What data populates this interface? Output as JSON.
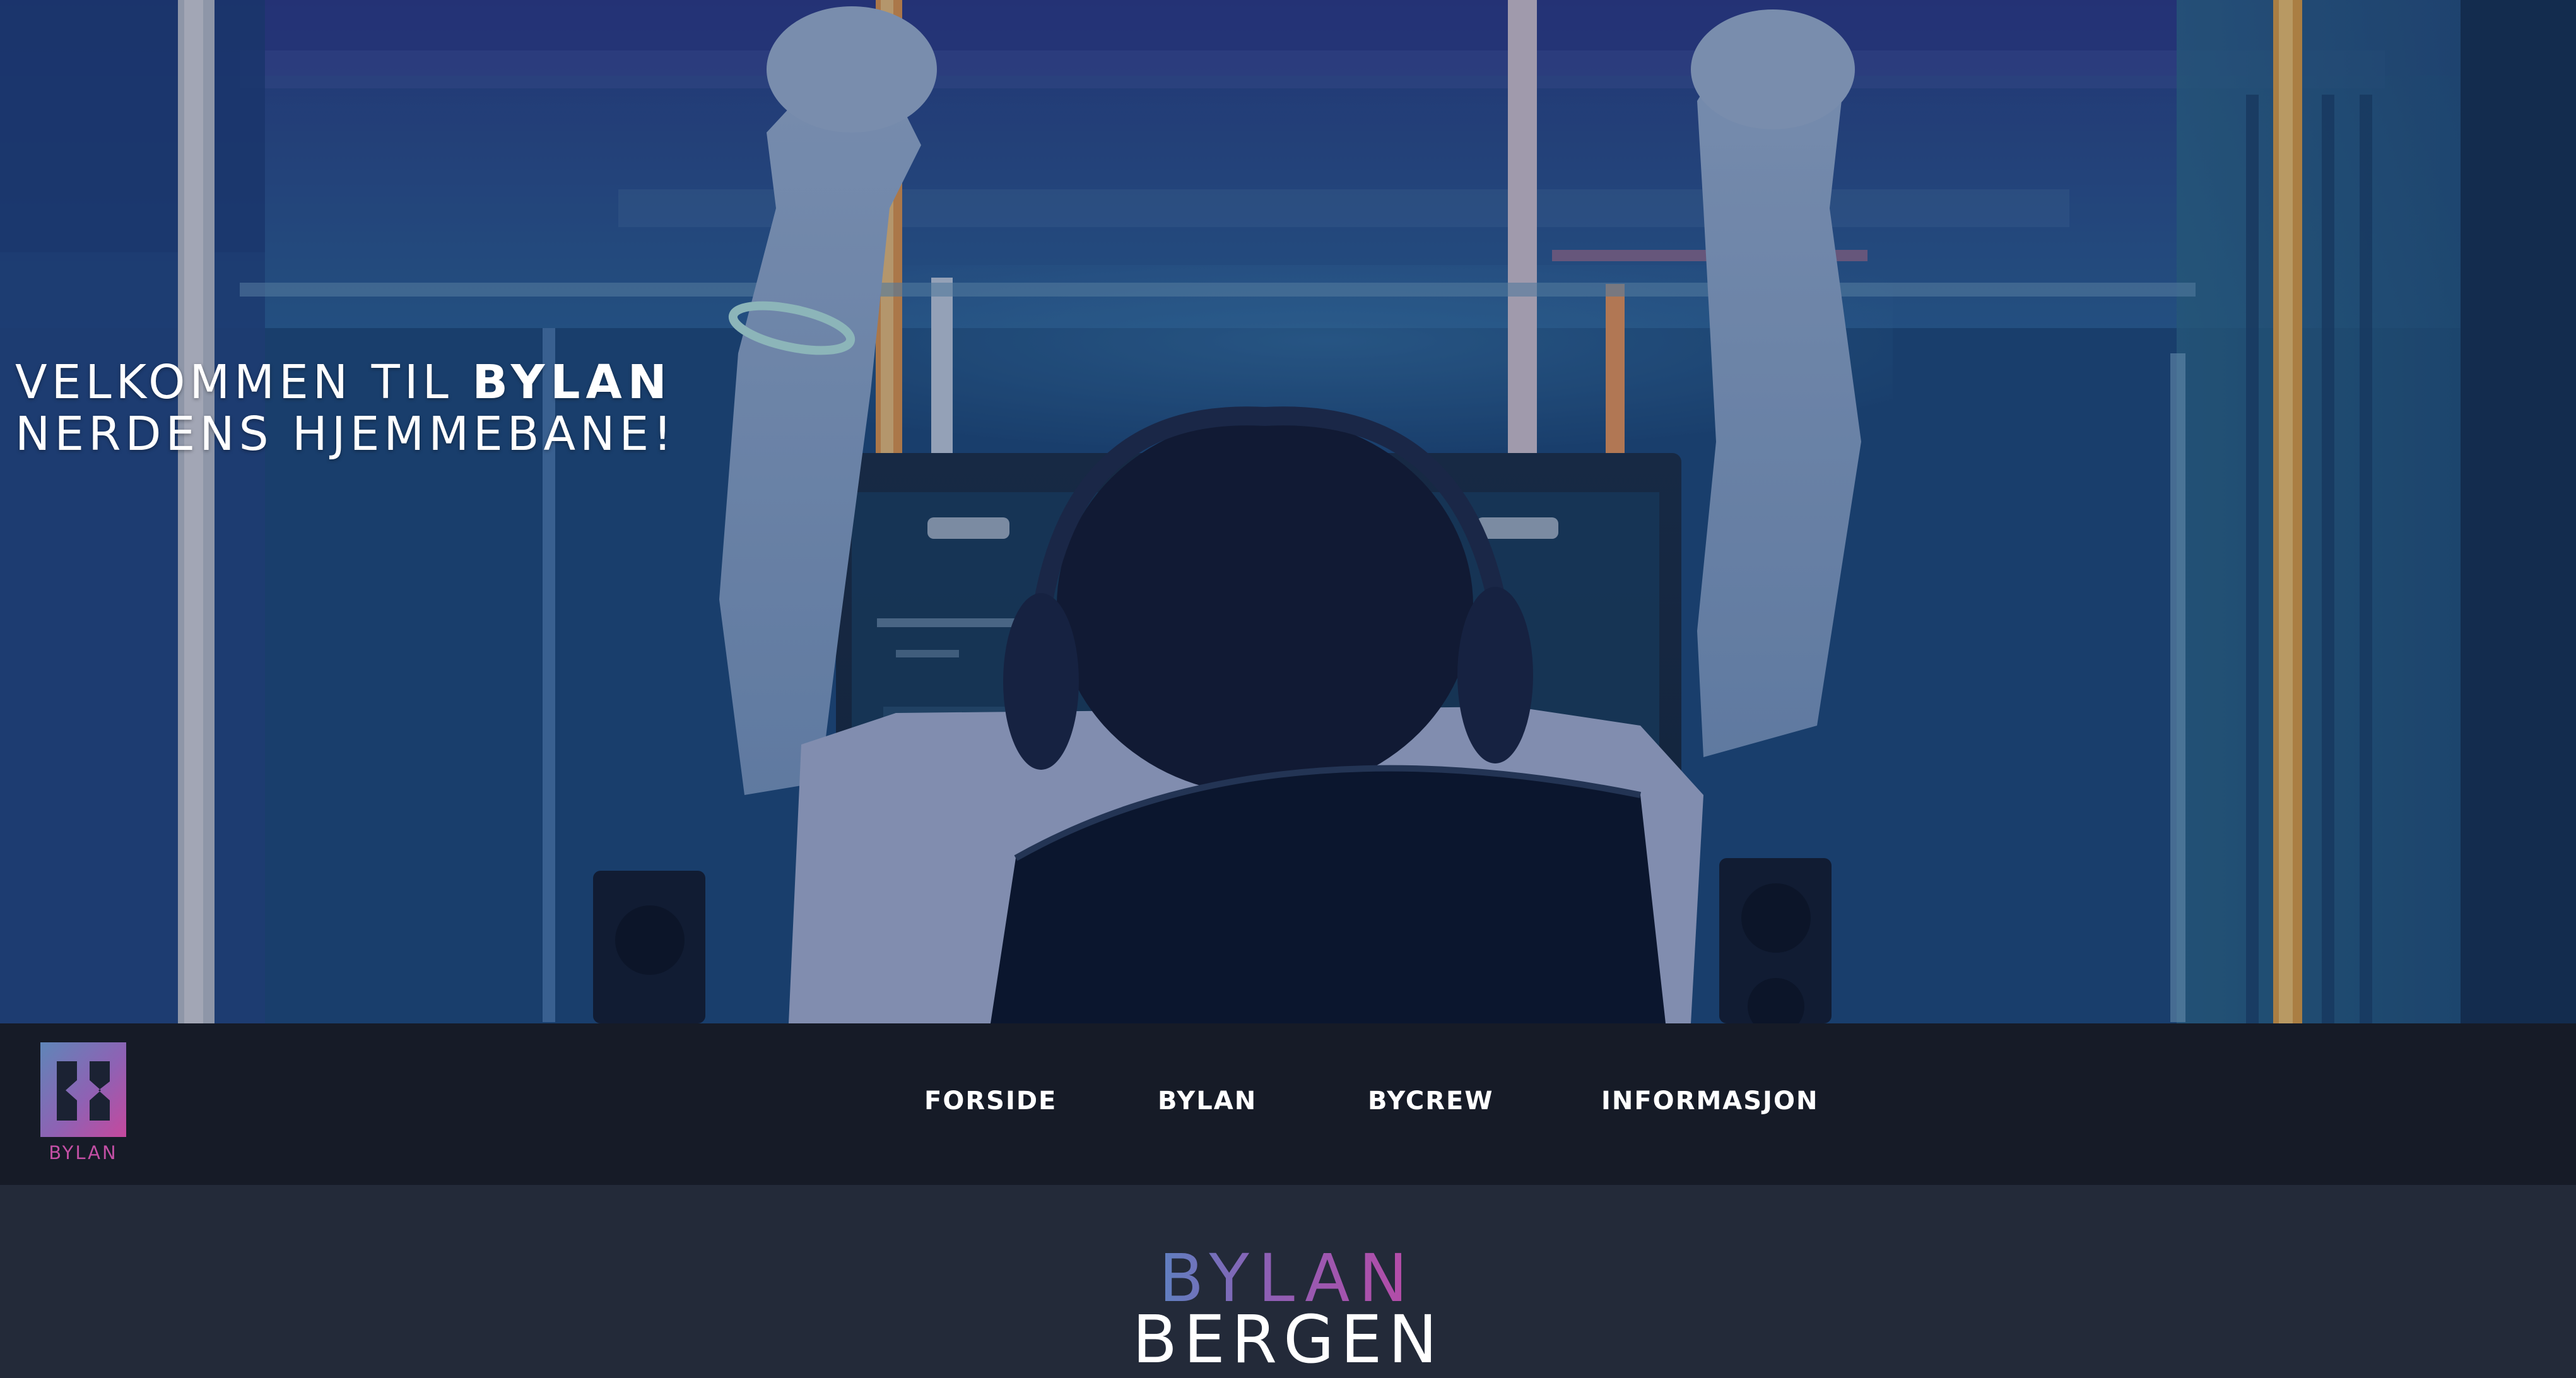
{
  "hero": {
    "line1_prefix": "VELKOMMEN TIL ",
    "line1_brand": "BYLAN",
    "line2": "NERDENS HJEMMEBANE!"
  },
  "navbar": {
    "logo_text": "BYLAN",
    "links": [
      {
        "label": "FORSIDE"
      },
      {
        "label": "BYLAN"
      },
      {
        "label": "BYCREW"
      },
      {
        "label": "INFORMASJON"
      }
    ]
  },
  "content": {
    "title": "BYLAN",
    "subtitle": "BERGEN"
  },
  "colors": {
    "navbar_bg": "#161b27",
    "content_bg": "#232a39",
    "brand_gradient_start": "#4f8ac4",
    "brand_gradient_end": "#c046a4",
    "text": "#ffffff"
  },
  "icons": {
    "logo": "bylan-logo-icon"
  }
}
